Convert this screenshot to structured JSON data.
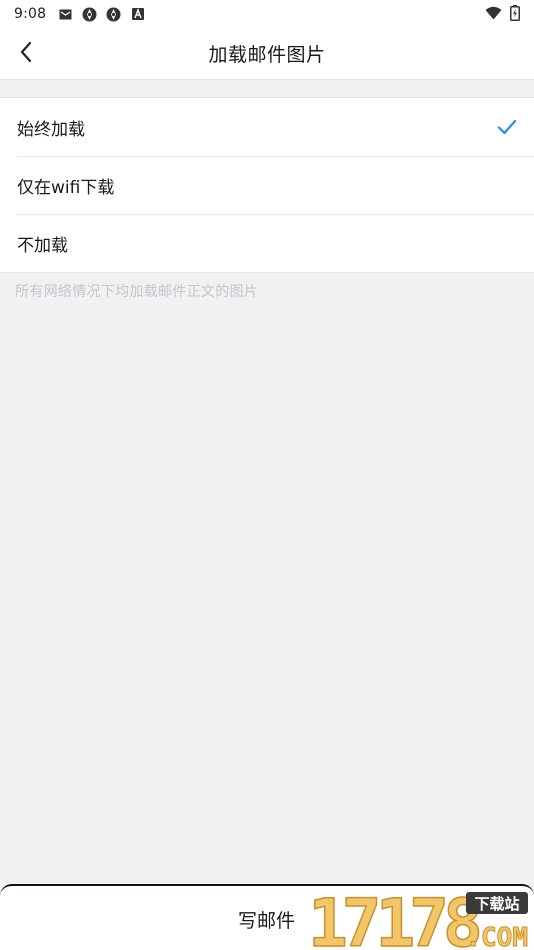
{
  "status_bar": {
    "time": "9:08"
  },
  "header": {
    "title": "加载邮件图片"
  },
  "options": [
    {
      "label": "始终加载",
      "selected": true
    },
    {
      "label": "仅在wifi下载",
      "selected": false
    },
    {
      "label": "不加载",
      "selected": false
    }
  ],
  "hint": "所有网络情况下均加载邮件正文的图片",
  "bottom_bar": {
    "compose_label": "写邮件"
  },
  "watermark": {
    "number": "17178",
    "tag": "下载站",
    "domain": ".COM"
  },
  "colors": {
    "accent": "#2c8ae8",
    "background": "#f0f1f3",
    "watermark_gold": "#e8b34a"
  },
  "icons": [
    "mail-icon",
    "sync-icon",
    "sync-icon",
    "a-icon",
    "wifi-icon",
    "battery-icon",
    "back-arrow-icon",
    "check-icon"
  ]
}
